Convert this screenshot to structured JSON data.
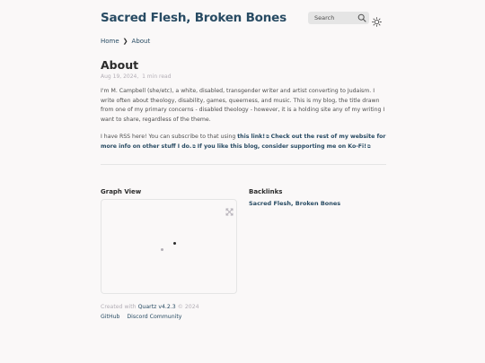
{
  "site": {
    "title": "Sacred Flesh, Broken Bones"
  },
  "search": {
    "label": "Search"
  },
  "icons": {
    "search": "search-icon",
    "theme": "sun-icon",
    "expand": "expand-icon",
    "external": "external-link-icon"
  },
  "breadcrumb": {
    "home": "Home",
    "separator": "❯",
    "current": "About"
  },
  "article": {
    "title": "About",
    "date": "Aug 19, 2024",
    "read_time": "1 min read",
    "p1": "I'm M. Campbell (she/etc), a white, disabled, transgender writer and artist converting to Judaism. I write often about theology, disability, games, queerness, and music. This is my blog, the title drawn from one of my primary concerns - disabled theology - however, it is a holding site any of my writing I want to share, regardless of the theme.",
    "p2_prefix": "I have RSS here! You can subscribe to that using ",
    "link1": "this link!",
    "link2": "Check out the rest of my website for more info on other stuff I do.",
    "link3": "If you like this blog, consider supporting me on Ko-Fi!"
  },
  "graph": {
    "title": "Graph View"
  },
  "backlinks": {
    "title": "Backlinks",
    "items": [
      "Sacred Flesh, Broken Bones"
    ]
  },
  "footer": {
    "created_prefix": "Created with",
    "quartz": "Quartz v4.2.3",
    "year": "© 2024",
    "links": [
      "GitHub",
      "Discord Community"
    ]
  },
  "colors": {
    "accent": "#284b63",
    "text": "#4e4e4e",
    "dark": "#2b2b2b",
    "muted": "#b3aeb6",
    "background": "#faf8f8"
  }
}
